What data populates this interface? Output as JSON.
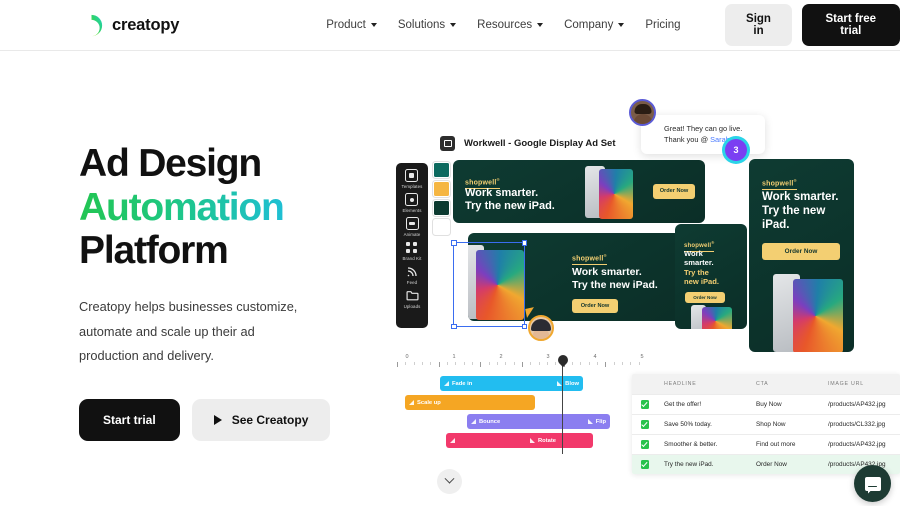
{
  "header": {
    "logo_text": "creatopy",
    "nav": [
      {
        "label": "Product",
        "has_caret": true
      },
      {
        "label": "Solutions",
        "has_caret": true
      },
      {
        "label": "Resources",
        "has_caret": true
      },
      {
        "label": "Company",
        "has_caret": true
      },
      {
        "label": "Pricing",
        "has_caret": false
      }
    ],
    "sign_in": "Sign in",
    "start_free_trial": "Start free trial"
  },
  "hero": {
    "headline_line1": "Ad Design",
    "headline_line2": "Automation",
    "headline_line3": "Platform",
    "subcopy": "Creatopy helps businesses customize, automate and scale up their ad production and delivery.",
    "primary_cta": "Start trial",
    "secondary_cta": "See Creatopy",
    "gradient_start": "#23c552",
    "gradient_end": "#1fbfd4"
  },
  "editor": {
    "document_title": "Workwell - Google Display Ad Set",
    "comment": {
      "line1": "Great! They can go live.",
      "line2_prefix": "Thank you @ ",
      "mention": "Sarah K!",
      "badge_count": "3"
    },
    "toolbar": [
      {
        "label": "Templates",
        "icon": "templates-icon"
      },
      {
        "label": "Elements",
        "icon": "elements-icon"
      },
      {
        "label": "Animate",
        "icon": "animate-icon"
      },
      {
        "label": "Brand Kit",
        "icon": "brand-kit-icon"
      },
      {
        "label": "Feed",
        "icon": "feed-icon"
      },
      {
        "label": "Uploads",
        "icon": "uploads-icon"
      }
    ],
    "swatches": [
      "#0d6a5f",
      "#f5b642",
      "#0c3a30",
      "#ffffff"
    ],
    "banner": {
      "brand": "shopwell",
      "headline_a": "Work smarter.",
      "headline_b": "Try the new iPad.",
      "headline_b_wrap1": "Try the new",
      "headline_b_wrap2": "iPad.",
      "headline_small1": "Work",
      "headline_small2": "smarter.",
      "headline_small3": "Try the",
      "headline_small4": "new iPad.",
      "cta": "Order Now",
      "bg_color": "#0e3b32",
      "accent_color": "#f3cf72"
    }
  },
  "timeline": {
    "ruler_labels": [
      "0",
      "1",
      "2",
      "3",
      "4",
      "5"
    ],
    "playhead_position": "3",
    "tracks": [
      {
        "label_left": "Fade in",
        "label_right": "Blow",
        "color": "#22bdf0"
      },
      {
        "label_left": "Scale up",
        "label_right": "",
        "color": "#f5a623"
      },
      {
        "label_left": "Bounce",
        "label_right": "Flip",
        "color": "#8b7ef0"
      },
      {
        "label_left": "",
        "label_right": "Rotate",
        "color": "#f2396b"
      }
    ]
  },
  "table": {
    "columns": [
      "HEADLINE",
      "CTA",
      "IMAGE URL"
    ],
    "rows": [
      {
        "checked": true,
        "headline": "Get the offer!",
        "cta": "Buy Now",
        "image_url": "/products/AP432.jpg",
        "selected": false
      },
      {
        "checked": true,
        "headline": "Save 50% today.",
        "cta": "Shop Now",
        "image_url": "/products/CL332.jpg",
        "selected": false
      },
      {
        "checked": true,
        "headline": "Smoother & better.",
        "cta": "Find out more",
        "image_url": "/products/AP432.jpg",
        "selected": false
      },
      {
        "checked": true,
        "headline": "Try the new iPad.",
        "cta": "Order Now",
        "image_url": "/products/AP432.jpg",
        "selected": true
      }
    ]
  },
  "widgets": {
    "scroll_down_icon": "chevron-down-icon",
    "chat_icon": "chat-bubble-icon"
  }
}
